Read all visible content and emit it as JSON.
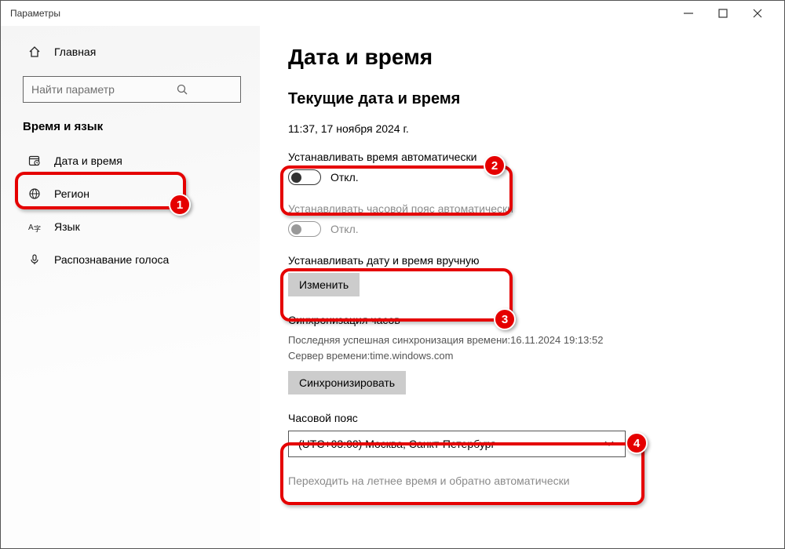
{
  "window": {
    "title": "Параметры"
  },
  "sidebar": {
    "home": "Главная",
    "search_placeholder": "Найти параметр",
    "section": "Время и язык",
    "items": [
      {
        "label": "Дата и время"
      },
      {
        "label": "Регион"
      },
      {
        "label": "Язык"
      },
      {
        "label": "Распознавание голоса"
      }
    ]
  },
  "main": {
    "heading": "Дата и время",
    "current_heading": "Текущие дата и время",
    "current_value": "11:37, 17 ноября 2024 г.",
    "auto_time_label": "Устанавливать время автоматически",
    "auto_time_state": "Откл.",
    "auto_tz_label": "Устанавливать часовой пояс автоматически",
    "auto_tz_state": "Откл.",
    "manual_label": "Устанавливать дату и время вручную",
    "manual_button": "Изменить",
    "sync_heading": "Синхронизация часов",
    "sync_last": "Последняя успешная синхронизация времени:16.11.2024 19:13:52",
    "sync_server": "Сервер времени:time.windows.com",
    "sync_button": "Синхронизировать",
    "tz_heading": "Часовой пояс",
    "tz_value": "(UTC+03:00) Москва, Санкт-Петербург",
    "dst_label": "Переходить на летнее время и обратно автоматически"
  },
  "annotations": [
    "1",
    "2",
    "3",
    "4"
  ]
}
